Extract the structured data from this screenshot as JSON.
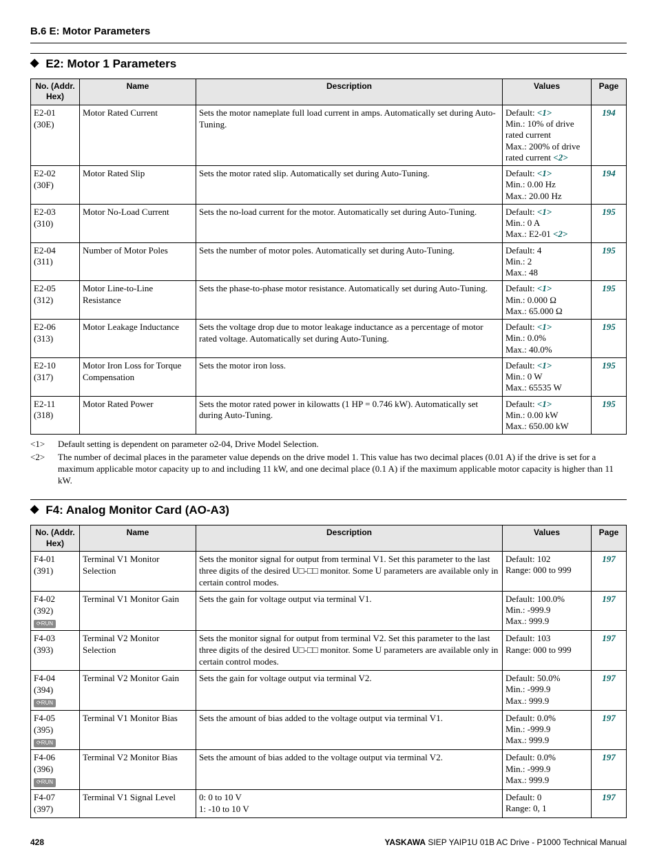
{
  "header": "B.6  E: Motor Parameters",
  "sectionA": {
    "title": "E2: Motor 1 Parameters",
    "columns": [
      "No. (Addr. Hex)",
      "Name",
      "Description",
      "Values",
      "Page"
    ],
    "rows": [
      {
        "no1": "E2-01",
        "no2": "(30E)",
        "badge": false,
        "name": "Motor Rated Current",
        "desc": "Sets the motor nameplate full load current in amps. Automatically set during Auto-Tuning.",
        "val_prefix": "Default: ",
        "val_sup1": "<1>",
        "val_lines": [
          "Min.: 10% of drive rated current",
          "Max.: 200% of drive rated current"
        ],
        "val_sup2": "<2>",
        "page": "194"
      },
      {
        "no1": "E2-02",
        "no2": "(30F)",
        "badge": false,
        "name": "Motor Rated Slip",
        "desc": "Sets the motor rated slip. Automatically set during Auto-Tuning.",
        "val_prefix": "Default: ",
        "val_sup1": "<1>",
        "val_lines": [
          "Min.: 0.00 Hz",
          "Max.: 20.00 Hz"
        ],
        "page": "194"
      },
      {
        "no1": "E2-03",
        "no2": "(310)",
        "badge": false,
        "name": "Motor No-Load Current",
        "desc": "Sets the no-load current for the motor. Automatically set during Auto-Tuning.",
        "val_prefix": "Default: ",
        "val_sup1": "<1>",
        "val_lines": [
          "Min.: 0 A"
        ],
        "val_max_prefix": "Max.: E2-01 ",
        "val_max_sup": "<2>",
        "page": "195"
      },
      {
        "no1": "E2-04",
        "no2": "(311)",
        "badge": false,
        "name": "Number of Motor Poles",
        "desc": "Sets the number of motor poles. Automatically set during Auto-Tuning.",
        "val_lines_plain": [
          "Default: 4",
          "Min.: 2",
          "Max.: 48"
        ],
        "page": "195"
      },
      {
        "no1": "E2-05",
        "no2": "(312)",
        "badge": false,
        "name": "Motor Line-to-Line Resistance",
        "desc": "Sets the phase-to-phase motor resistance. Automatically set during Auto-Tuning.",
        "val_prefix": "Default: ",
        "val_sup1": "<1>",
        "val_lines": [
          "Min.: 0.000 Ω",
          "Max.: 65.000 Ω"
        ],
        "page": "195"
      },
      {
        "no1": "E2-06",
        "no2": "(313)",
        "badge": false,
        "name": "Motor Leakage Inductance",
        "desc": "Sets the voltage drop due to motor leakage inductance as a percentage of motor rated voltage. Automatically set during Auto-Tuning.",
        "val_prefix": "Default: ",
        "val_sup1": "<1>",
        "val_lines": [
          "Min.: 0.0%",
          "Max.: 40.0%"
        ],
        "page": "195"
      },
      {
        "no1": "E2-10",
        "no2": "(317)",
        "badge": false,
        "name": "Motor Iron Loss for Torque Compensation",
        "desc": "Sets the motor iron loss.",
        "val_prefix": "Default: ",
        "val_sup1": "<1>",
        "val_lines": [
          "Min.: 0 W",
          "Max.: 65535 W"
        ],
        "page": "195"
      },
      {
        "no1": "E2-11",
        "no2": "(318)",
        "badge": false,
        "name": "Motor Rated Power",
        "desc": "Sets the motor rated power in kilowatts (1 HP = 0.746 kW). Automatically set during Auto-Tuning.",
        "val_prefix": "Default: ",
        "val_sup1": "<1>",
        "val_lines": [
          "Min.: 0.00 kW",
          "Max.: 650.00 kW"
        ],
        "page": "195"
      }
    ]
  },
  "footnotes": [
    {
      "tag": "<1>",
      "text": "Default setting is dependent on parameter o2-04, Drive Model Selection."
    },
    {
      "tag": "<2>",
      "text": "The number of decimal places in the parameter value depends on the drive model 1. This value has two decimal places (0.01 A) if the drive is set for a maximum applicable motor capacity up to and including 11 kW, and one decimal place (0.1 A) if the maximum applicable motor capacity is higher than 11 kW."
    }
  ],
  "sectionB": {
    "title": "F4: Analog Monitor Card (AO-A3)",
    "columns": [
      "No. (Addr. Hex)",
      "Name",
      "Description",
      "Values",
      "Page"
    ],
    "rows": [
      {
        "no1": "F4-01",
        "no2": "(391)",
        "badge": false,
        "name": "Terminal V1 Monitor Selection",
        "desc": "Sets the monitor signal for output from terminal V1. Set this parameter to the last three digits of the desired U□-□□ monitor. Some U parameters are available only in certain control modes.",
        "val_lines_plain": [
          "Default: 102",
          "Range: 000 to 999"
        ],
        "page": "197"
      },
      {
        "no1": "F4-02",
        "no2": "(392)",
        "badge": true,
        "name": "Terminal V1 Monitor Gain",
        "desc": "Sets the gain for voltage output via terminal V1.",
        "val_lines_plain": [
          "Default: 100.0%",
          "Min.: -999.9",
          "Max.: 999.9"
        ],
        "page": "197"
      },
      {
        "no1": "F4-03",
        "no2": "(393)",
        "badge": false,
        "name": "Terminal V2 Monitor Selection",
        "desc": "Sets the monitor signal for output from terminal V2. Set this parameter to the last three digits of the desired U□-□□ monitor. Some U parameters are available only in certain control modes.",
        "val_lines_plain": [
          "Default: 103",
          "Range: 000 to 999"
        ],
        "page": "197"
      },
      {
        "no1": "F4-04",
        "no2": "(394)",
        "badge": true,
        "name": "Terminal V2 Monitor Gain",
        "desc": "Sets the gain for voltage output via terminal V2.",
        "val_lines_plain": [
          "Default: 50.0%",
          "Min.: -999.9",
          "Max.: 999.9"
        ],
        "page": "197"
      },
      {
        "no1": "F4-05",
        "no2": "(395)",
        "badge": true,
        "name": "Terminal V1 Monitor Bias",
        "desc": "Sets the amount of bias added to the voltage output via terminal V1.",
        "val_lines_plain": [
          "Default: 0.0%",
          "Min.: -999.9",
          "Max.: 999.9"
        ],
        "page": "197"
      },
      {
        "no1": "F4-06",
        "no2": "(396)",
        "badge": true,
        "name": "Terminal V2 Monitor Bias",
        "desc": "Sets the amount of bias added to the voltage output via terminal V2.",
        "val_lines_plain": [
          "Default: 0.0%",
          "Min.: -999.9",
          "Max.: 999.9"
        ],
        "page": "197"
      },
      {
        "no1": "F4-07",
        "no2": "(397)",
        "badge": false,
        "name": "Terminal V1 Signal Level",
        "desc_lines": [
          "0: 0 to 10 V",
          "1: -10 to 10 V"
        ],
        "val_lines_plain": [
          "Default: 0",
          "Range: 0, 1"
        ],
        "page": "197"
      }
    ]
  },
  "footer": {
    "page": "428",
    "brand": "YASKAWA",
    "doc": " SIEP YAIP1U 01B AC Drive - P1000 Technical Manual"
  },
  "runBadgeText": "⟳RUN"
}
